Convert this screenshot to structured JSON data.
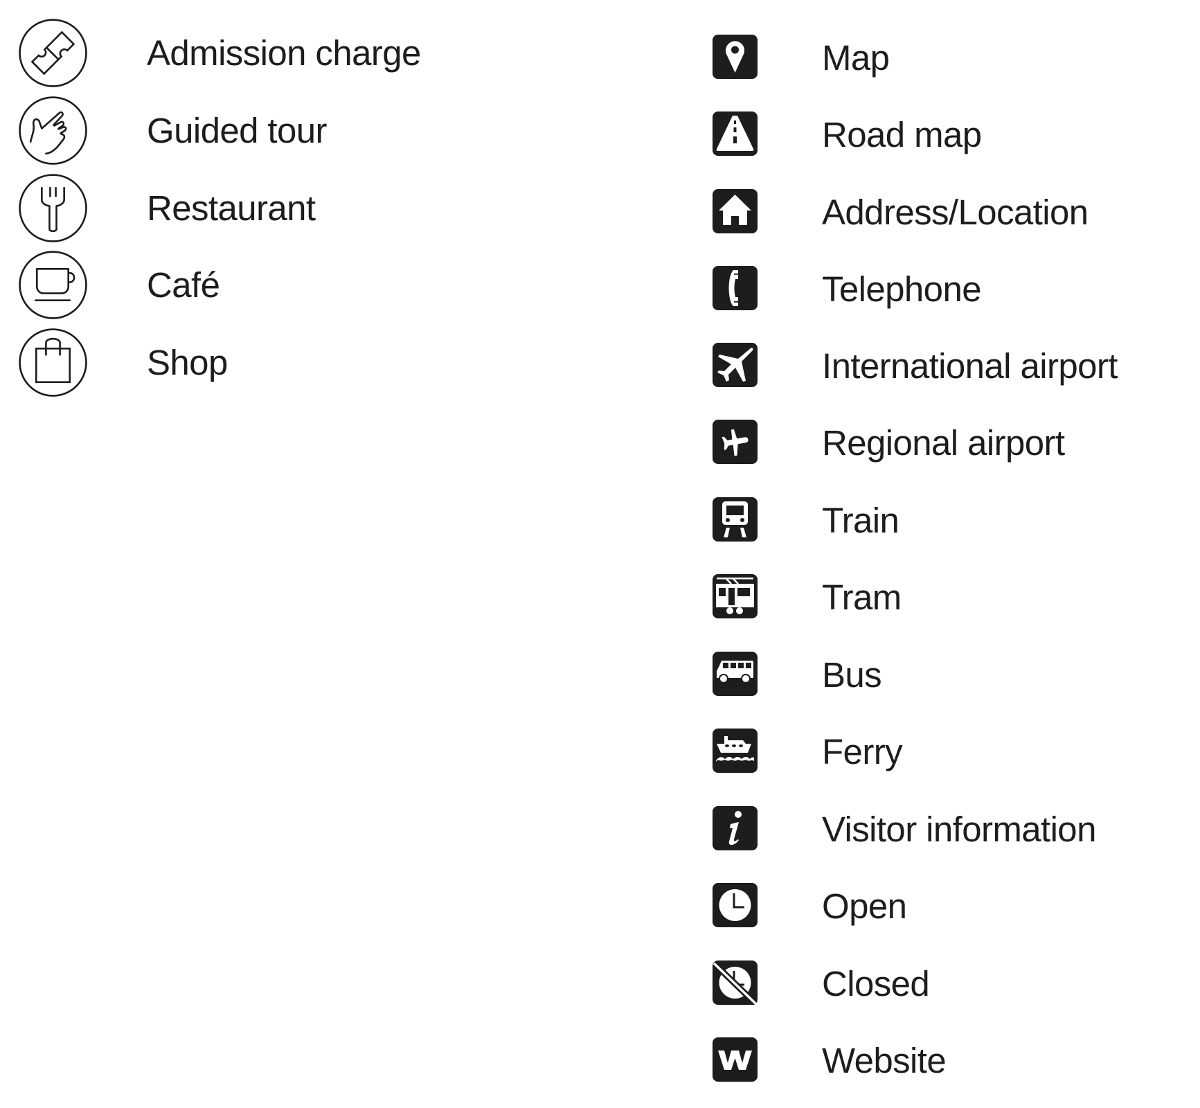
{
  "legend": {
    "attractions": [
      {
        "icon": "ticket-icon",
        "label": "Admission charge"
      },
      {
        "icon": "pointing-hand-icon",
        "label": "Guided tour"
      },
      {
        "icon": "fork-icon",
        "label": "Restaurant"
      },
      {
        "icon": "coffee-cup-icon",
        "label": "Café"
      },
      {
        "icon": "shopping-bag-icon",
        "label": "Shop"
      }
    ],
    "practical": [
      {
        "icon": "map-pin-icon",
        "label": "Map"
      },
      {
        "icon": "road-icon",
        "label": "Road map"
      },
      {
        "icon": "house-icon",
        "label": "Address/Location"
      },
      {
        "icon": "telephone-icon",
        "label": "Telephone"
      },
      {
        "icon": "large-airplane-icon",
        "label": "International airport"
      },
      {
        "icon": "small-airplane-icon",
        "label": "Regional airport"
      },
      {
        "icon": "train-icon",
        "label": "Train"
      },
      {
        "icon": "tram-icon",
        "label": "Tram"
      },
      {
        "icon": "bus-icon",
        "label": "Bus"
      },
      {
        "icon": "ferry-icon",
        "label": "Ferry"
      },
      {
        "icon": "info-icon",
        "label": "Visitor information"
      },
      {
        "icon": "clock-icon",
        "label": "Open"
      },
      {
        "icon": "clock-crossed-icon",
        "label": "Closed"
      },
      {
        "icon": "website-w-icon",
        "label": "Website"
      }
    ]
  },
  "colors": {
    "ink": "#1d1d1b",
    "background": "#ffffff"
  }
}
